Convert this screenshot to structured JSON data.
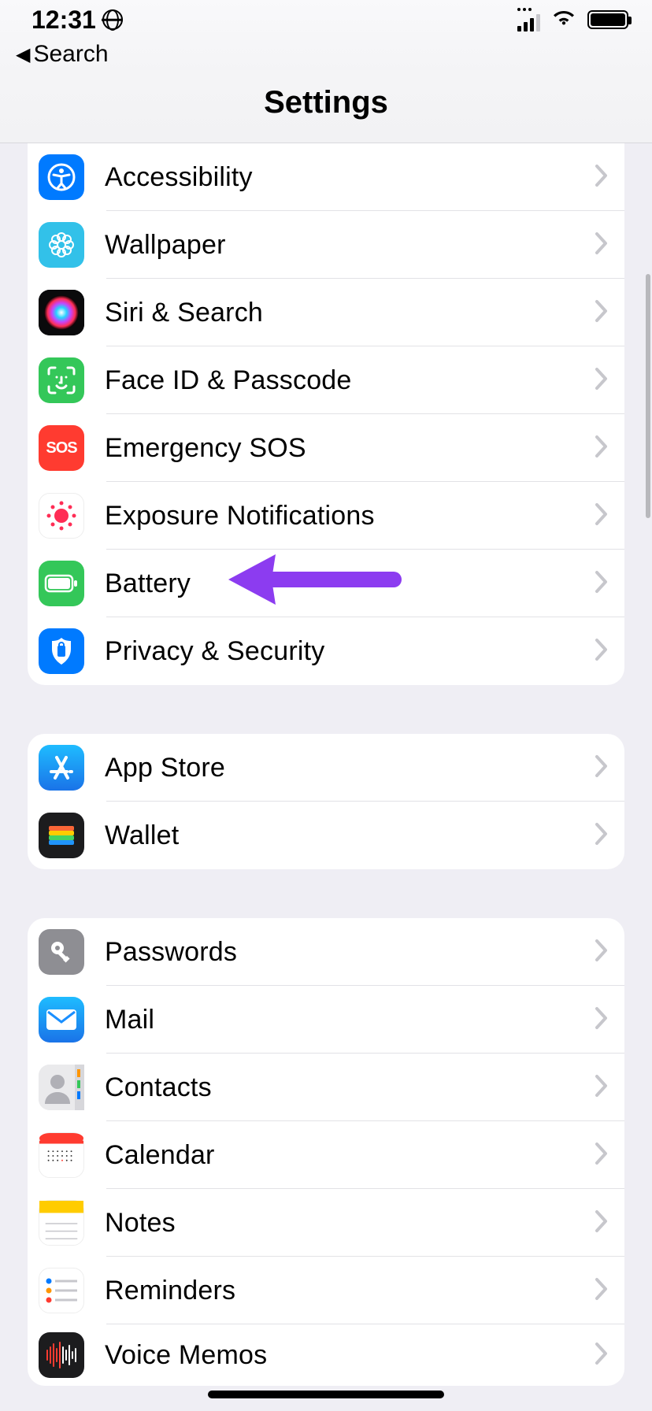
{
  "status": {
    "time": "12:31",
    "back_label": "Search"
  },
  "header": {
    "title": "Settings"
  },
  "sections": [
    {
      "rows": [
        {
          "label": "Accessibility",
          "icon": "accessibility-icon"
        },
        {
          "label": "Wallpaper",
          "icon": "wallpaper-icon"
        },
        {
          "label": "Siri & Search",
          "icon": "siri-icon"
        },
        {
          "label": "Face ID & Passcode",
          "icon": "faceid-icon"
        },
        {
          "label": "Emergency SOS",
          "icon": "sos-icon"
        },
        {
          "label": "Exposure Notifications",
          "icon": "exposure-icon"
        },
        {
          "label": "Battery",
          "icon": "battery-icon"
        },
        {
          "label": "Privacy & Security",
          "icon": "privacy-icon"
        }
      ]
    },
    {
      "rows": [
        {
          "label": "App Store",
          "icon": "appstore-icon"
        },
        {
          "label": "Wallet",
          "icon": "wallet-icon"
        }
      ]
    },
    {
      "rows": [
        {
          "label": "Passwords",
          "icon": "passwords-icon"
        },
        {
          "label": "Mail",
          "icon": "mail-icon"
        },
        {
          "label": "Contacts",
          "icon": "contacts-icon"
        },
        {
          "label": "Calendar",
          "icon": "calendar-icon"
        },
        {
          "label": "Notes",
          "icon": "notes-icon"
        },
        {
          "label": "Reminders",
          "icon": "reminders-icon"
        },
        {
          "label": "Voice Memos",
          "icon": "voicememos-icon"
        }
      ]
    }
  ],
  "annotation": {
    "arrow_target": "Battery",
    "arrow_color": "#8c3cf0"
  }
}
